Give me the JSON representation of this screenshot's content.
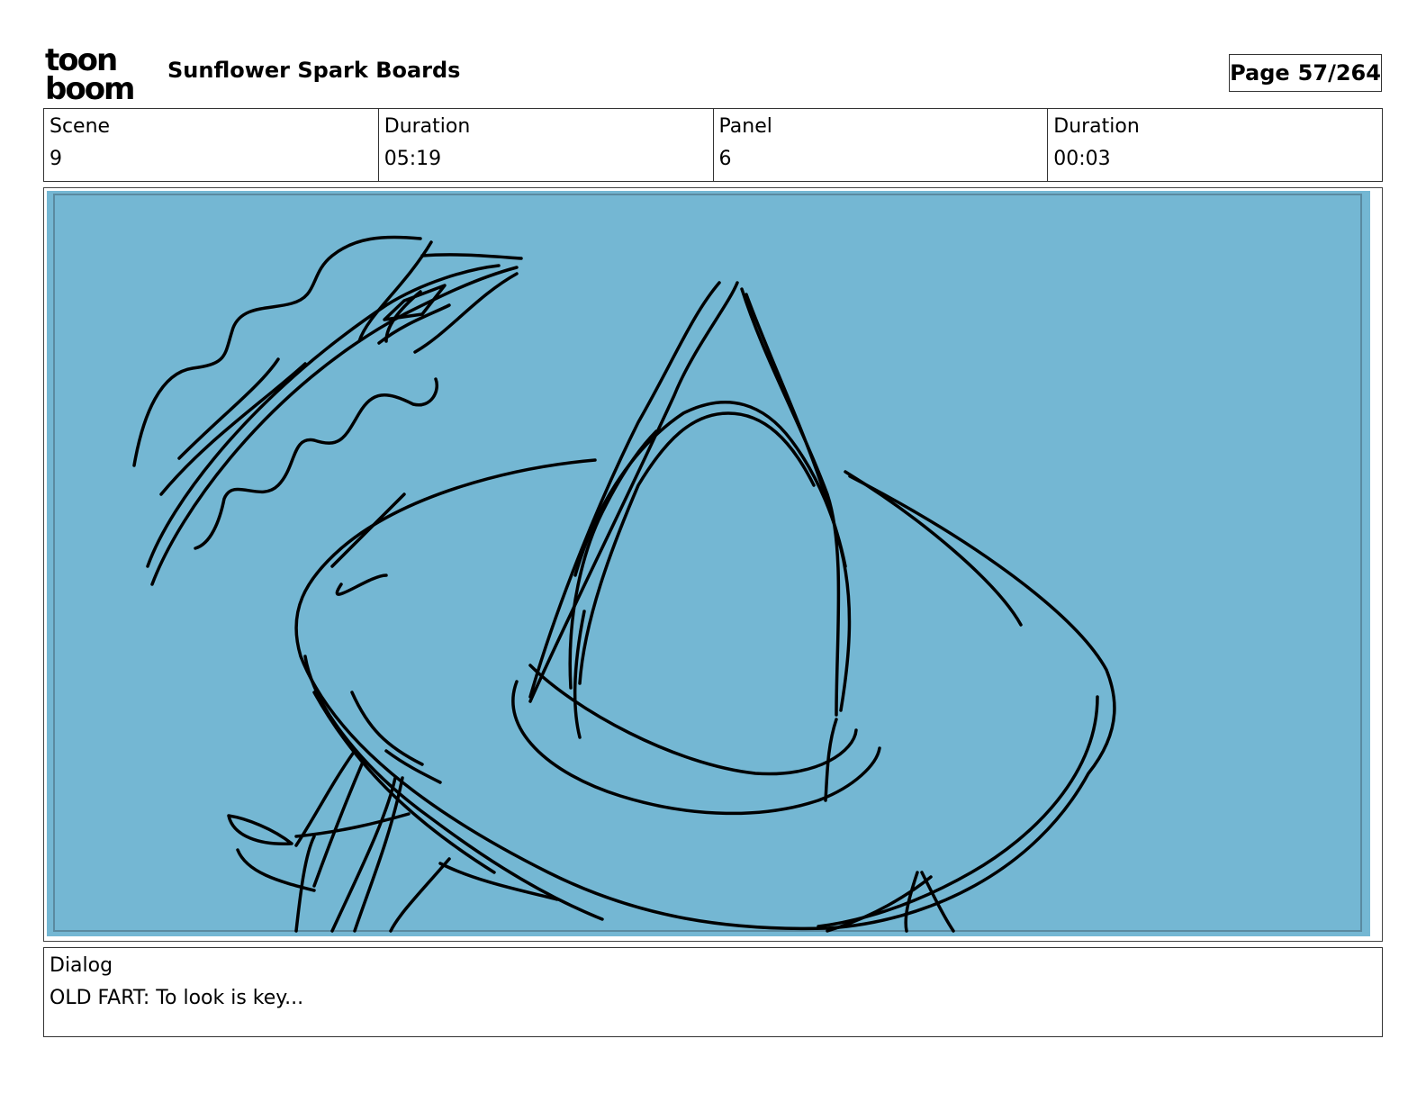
{
  "header": {
    "logo": {
      "line1": "toon",
      "line2": "boom"
    },
    "title": "Sunflower Spark Boards",
    "page_label": "Page",
    "page_number": "57/264"
  },
  "info": {
    "scene_label": "Scene",
    "scene_value": "9",
    "scene_duration_label": "Duration",
    "scene_duration_value": "05:19",
    "panel_label": "Panel",
    "panel_value": "6",
    "panel_duration_label": "Duration",
    "panel_duration_value": "00:03"
  },
  "panel": {
    "background_color": "#74b7d3",
    "border_color": "#5a8aa0",
    "stroke_color": "#000000"
  },
  "dialog": {
    "label": "Dialog",
    "text": "OLD FART: To look is key..."
  }
}
